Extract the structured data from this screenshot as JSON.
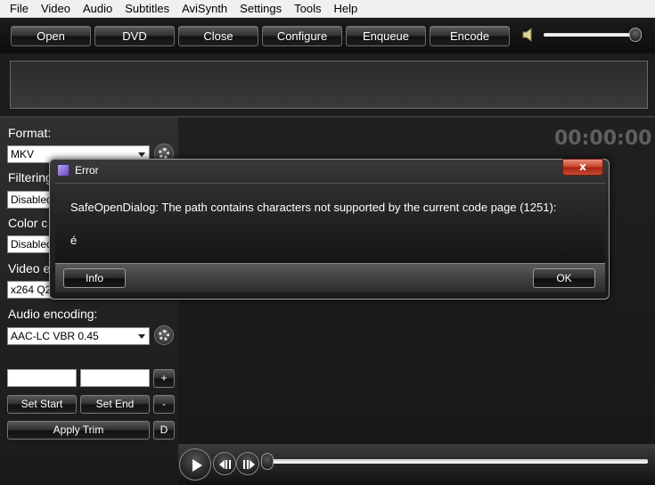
{
  "menu": [
    "File",
    "Video",
    "Audio",
    "Subtitles",
    "AviSynth",
    "Settings",
    "Tools",
    "Help"
  ],
  "toolbar": {
    "buttons": [
      "Open",
      "DVD",
      "Close",
      "Configure",
      "Enqueue",
      "Encode"
    ],
    "volume_level": 0.95
  },
  "panel": {
    "format_label": "Format:",
    "format_value": "MKV",
    "filtering_label": "Filtering",
    "filtering_value": "Disabled",
    "color_label": "Color c",
    "color_value": "Disabled",
    "video_label": "Video e",
    "video_value": "x264 Q2",
    "audio_label": "Audio encoding:",
    "audio_value": "AAC-LC VBR 0.45",
    "trim_plus": "+",
    "trim_minus": "-",
    "set_start": "Set Start",
    "set_end": "Set End",
    "apply_trim": "Apply Trim",
    "d_button": "D"
  },
  "timer": "00:00:00",
  "dialog": {
    "title": "Error",
    "close": "x",
    "message": "SafeOpenDialog: The path contains characters not supported by the current code page (1251):",
    "detail": "é",
    "info_button": "Info",
    "ok_button": "OK"
  },
  "player": {
    "seek_position": 0.0
  }
}
